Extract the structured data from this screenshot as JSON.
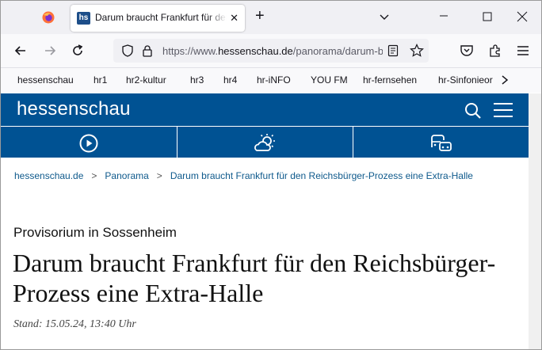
{
  "browser": {
    "tab_title": "Darum braucht Frankfurt für den Reichsbürger-Prozess eine Extra-Halle – hessenschau.de",
    "tab_favicon_text": "hs",
    "url_prefix": "https://www.",
    "url_domain": "hessenschau.de",
    "url_path": "/panorama/darum-braucht-frankfurt",
    "icons": [
      "firefox-icon",
      "close-icon",
      "plus-icon",
      "chevron-down-icon",
      "minimize-icon",
      "maximize-icon",
      "close-window-icon",
      "back-icon",
      "forward-icon",
      "reload-icon",
      "shield-icon",
      "lock-icon",
      "reader-icon",
      "star-icon",
      "pocket-icon",
      "extensions-icon",
      "menu-icon"
    ]
  },
  "bookmarks": [
    "hessenschau",
    "hr1",
    "hr2-kultur",
    "hr3",
    "hr4",
    "hr-iNFO",
    "YOU FM",
    "hr-fernsehen",
    "hr-Sinfonieor"
  ],
  "site": {
    "logo": "hessenschau",
    "brand_color": "#005293",
    "iconbar": [
      "play-icon",
      "weather-icon",
      "traffic-icon"
    ]
  },
  "breadcrumb": [
    "hessenschau.de",
    "Panorama",
    "Darum braucht Frankfurt für den Reichsbürger-Prozess eine Extra-Halle"
  ],
  "breadcrumb_sep": ">",
  "article": {
    "kicker": "Provisorium in Sossenheim",
    "headline": "Darum braucht Frankfurt für den Reichsbürger-Prozess eine Extra-Halle",
    "stand": "Stand: 15.05.24, 13:40 Uhr"
  }
}
